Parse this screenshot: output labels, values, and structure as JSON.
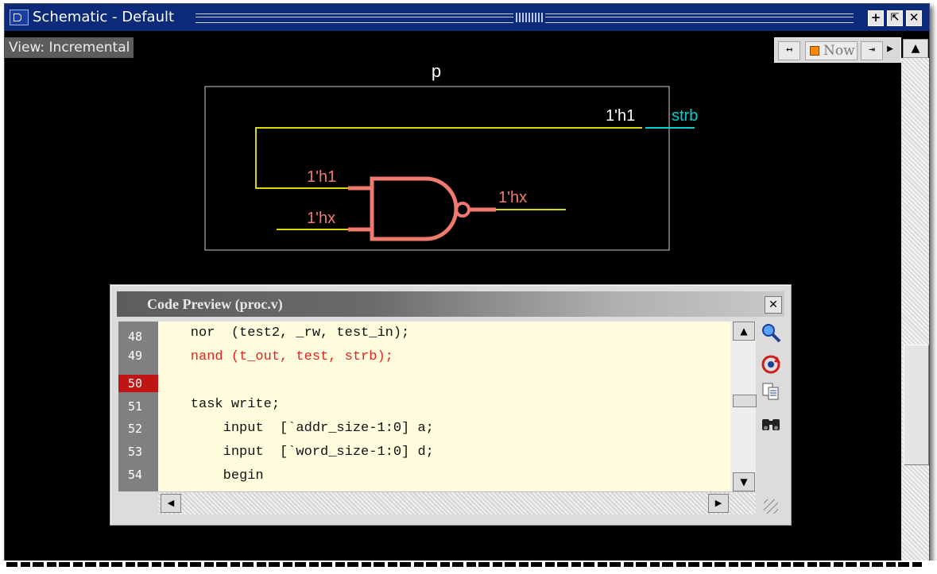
{
  "window": {
    "title": "Schematic - Default",
    "buttons": {
      "maximize": "+",
      "restore": "⇱",
      "close": "✕"
    }
  },
  "view_label": "View: Incremental",
  "toolbar": {
    "now_label": "Now",
    "left_tool": "↤",
    "right_tool": "⇥",
    "play_label": "▶",
    "up_label": "▲"
  },
  "schematic": {
    "instance_name": "p",
    "output_value": "1'h1",
    "output_net": "strb",
    "input_a_value": "1'h1",
    "input_b_value": "1'hx",
    "gate_output_value": "1'hx"
  },
  "code_preview": {
    "title": "Code Preview (proc.v)",
    "line_numbers": [
      "48",
      "49",
      "50",
      "51",
      "52",
      "53",
      "54"
    ],
    "active_line": "50",
    "lines": [
      "    nor  (test2, _rw, test_in);",
      "    nand (t_out, test, strb);",
      "",
      "    task write;",
      "        input  [`addr_size-1:0] a;",
      "        input  [`word_size-1:0] d;",
      "        begin"
    ],
    "highlighted_line_index": 1,
    "tools": [
      "zoom-icon",
      "refresh-icon",
      "copy-icon",
      "find-icon"
    ]
  },
  "colors": {
    "titlebar": "#0b2a7a",
    "wire": "#d8d800",
    "gate": "#f07a6e",
    "net_label": "#00d0d0",
    "highlight_text": "#e62020",
    "active_line_bg": "#c01515"
  }
}
